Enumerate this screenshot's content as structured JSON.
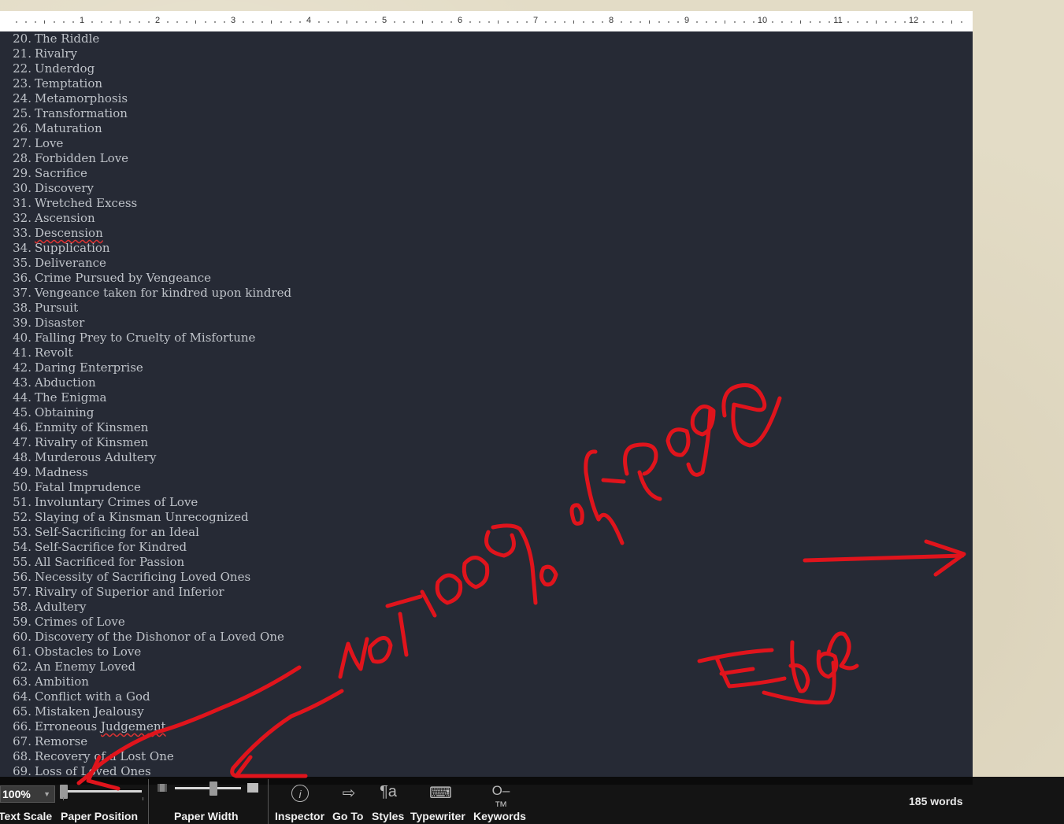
{
  "ruler": {
    "numbers": [
      "1",
      "2",
      "3",
      "4",
      "5",
      "6",
      "7",
      "8",
      "9",
      "10",
      "11",
      "12"
    ]
  },
  "document": {
    "items": [
      {
        "num": "20.",
        "title": "The Riddle"
      },
      {
        "num": "21.",
        "title": "Rivalry"
      },
      {
        "num": "22.",
        "title": "Underdog"
      },
      {
        "num": "23.",
        "title": "Temptation"
      },
      {
        "num": "24.",
        "title": "Metamorphosis"
      },
      {
        "num": "25.",
        "title": "Transformation"
      },
      {
        "num": "26.",
        "title": "Maturation"
      },
      {
        "num": "27.",
        "title": "Love"
      },
      {
        "num": "28.",
        "title": "Forbidden Love"
      },
      {
        "num": "29.",
        "title": "Sacrifice"
      },
      {
        "num": "30.",
        "title": "Discovery"
      },
      {
        "num": "31.",
        "title": "Wretched Excess"
      },
      {
        "num": "32.",
        "title": "Ascension"
      },
      {
        "num": "33.",
        "title": "Descension",
        "misspelled": true
      },
      {
        "num": "34.",
        "title": "Supplication"
      },
      {
        "num": "35.",
        "title": "Deliverance"
      },
      {
        "num": "36.",
        "title": "Crime Pursued by Vengeance"
      },
      {
        "num": "37.",
        "title": "Vengeance taken for kindred upon kindred"
      },
      {
        "num": "38.",
        "title": "Pursuit"
      },
      {
        "num": "39.",
        "title": "Disaster"
      },
      {
        "num": "40.",
        "title": "Falling Prey to Cruelty of Misfortune"
      },
      {
        "num": "41.",
        "title": "Revolt"
      },
      {
        "num": "42.",
        "title": "Daring Enterprise"
      },
      {
        "num": "43.",
        "title": "Abduction"
      },
      {
        "num": "44.",
        "title": "The Enigma"
      },
      {
        "num": "45.",
        "title": "Obtaining"
      },
      {
        "num": "46.",
        "title": "Enmity of Kinsmen"
      },
      {
        "num": "47.",
        "title": "Rivalry of Kinsmen"
      },
      {
        "num": "48.",
        "title": "Murderous Adultery"
      },
      {
        "num": "49.",
        "title": "Madness"
      },
      {
        "num": "50.",
        "title": "Fatal Imprudence"
      },
      {
        "num": "51.",
        "title": "Involuntary Crimes of Love"
      },
      {
        "num": "52.",
        "title": "Slaying of a Kinsman Unrecognized"
      },
      {
        "num": "53.",
        "title": "Self-Sacrificing for an Ideal"
      },
      {
        "num": "54.",
        "title": "Self-Sacrifice for Kindred"
      },
      {
        "num": "55.",
        "title": "All Sacrificed for Passion"
      },
      {
        "num": "56.",
        "title": "Necessity of Sacrificing Loved Ones"
      },
      {
        "num": "57.",
        "title": "Rivalry of Superior and Inferior"
      },
      {
        "num": "58.",
        "title": "Adultery"
      },
      {
        "num": "59.",
        "title": "Crimes of Love"
      },
      {
        "num": "60.",
        "title": "Discovery of the Dishonor of a Loved One"
      },
      {
        "num": "61.",
        "title": "Obstacles to Love"
      },
      {
        "num": "62.",
        "title": "An Enemy Loved"
      },
      {
        "num": "63.",
        "title": "Ambition"
      },
      {
        "num": "64.",
        "title": "Conflict with a God"
      },
      {
        "num": "65.",
        "title": "Mistaken Jealousy"
      },
      {
        "num": "66.",
        "title": "Erroneous Judgement",
        "misspelled_word": "Judgement"
      },
      {
        "num": "67.",
        "title": "Remorse"
      },
      {
        "num": "68.",
        "title": "Recovery of a Lost One"
      },
      {
        "num": "69.",
        "title": "Loss of Loved Ones"
      }
    ]
  },
  "footer": {
    "zoom_value": "100%",
    "labels": {
      "text_scale": "Text Scale",
      "paper_position": "Paper Position",
      "paper_width": "Paper Width",
      "inspector": "Inspector",
      "go_to": "Go To",
      "styles": "Styles",
      "typewriter": "Typewriter",
      "keywords": "Keywords"
    },
    "icons": {
      "inspector": "info-icon",
      "go_to": "goto-icon",
      "styles": "styles-icon",
      "typewriter": "typewriter-icon",
      "keywords": "key-icon"
    },
    "word_count": "185 words"
  },
  "annotation": {
    "color": "#e0141c",
    "handwritten": [
      "NOT 100% page",
      "Edge"
    ]
  }
}
